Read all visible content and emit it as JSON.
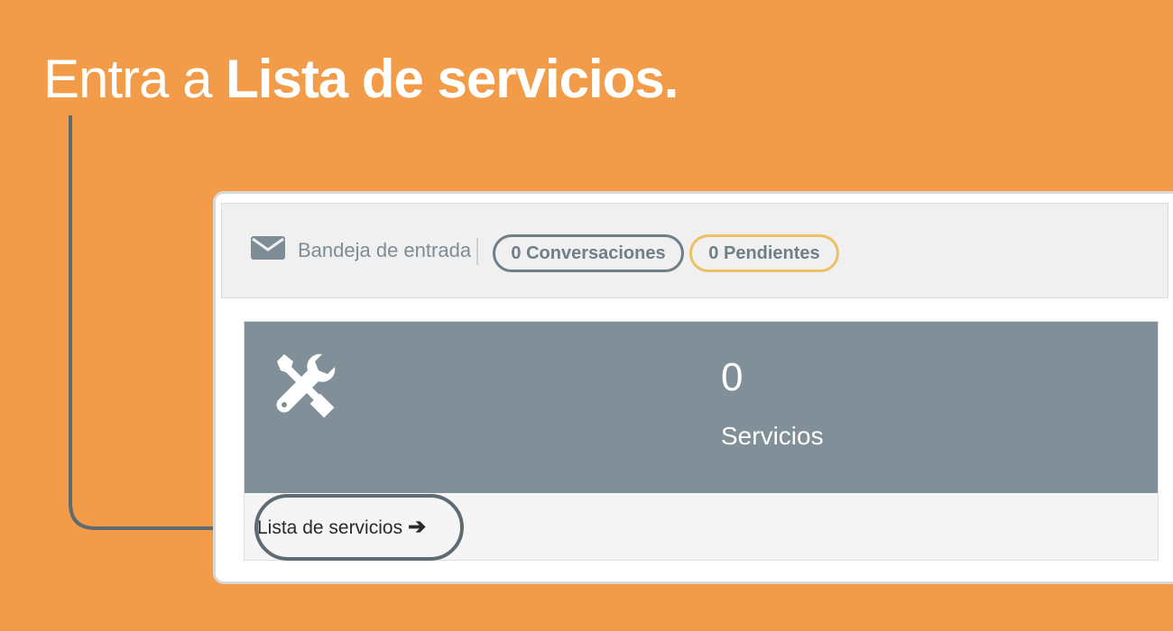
{
  "headline": {
    "prefix": "Entra a ",
    "emphasis": "Lista de servicios."
  },
  "topbar": {
    "inbox_icon": "envelope-icon",
    "inbox_label": "Bandeja de entrada",
    "conversations_label": "0 Conversaciones",
    "pending_label": "0 Pendientes"
  },
  "services_card": {
    "icon": "tools-icon",
    "count": "0",
    "label": "Servicios",
    "link_label": "Lista de servicios",
    "link_icon": "arrow-right-icon"
  },
  "colors": {
    "background": "#F29C4A",
    "card_header": "#818F98",
    "pill_conversations": "#6F7E87",
    "pill_pending": "#EDC064",
    "connector": "#5E6B73"
  }
}
